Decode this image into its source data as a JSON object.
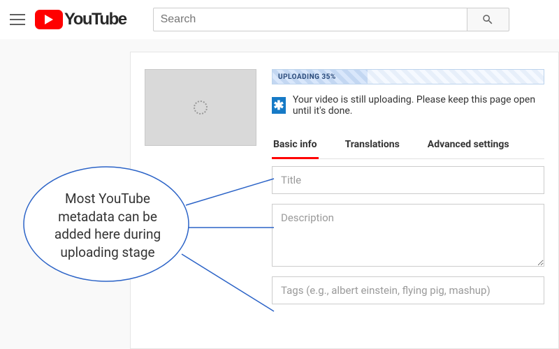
{
  "header": {
    "logo_text": "YouTube",
    "search_placeholder": "Search"
  },
  "upload": {
    "progress_label": "UPLOADING 35%",
    "progress_percent": 35,
    "notice_icon": "✱",
    "notice_text": "Your video is still uploading. Please keep this page open until it's done."
  },
  "tabs": {
    "basic": "Basic info",
    "translations": "Translations",
    "advanced": "Advanced settings"
  },
  "fields": {
    "title_placeholder": "Title",
    "description_placeholder": "Description",
    "tags_placeholder": "Tags (e.g., albert einstein, flying pig, mashup)"
  },
  "callout": {
    "text": "Most YouTube metadata can be added here during uploading stage"
  }
}
